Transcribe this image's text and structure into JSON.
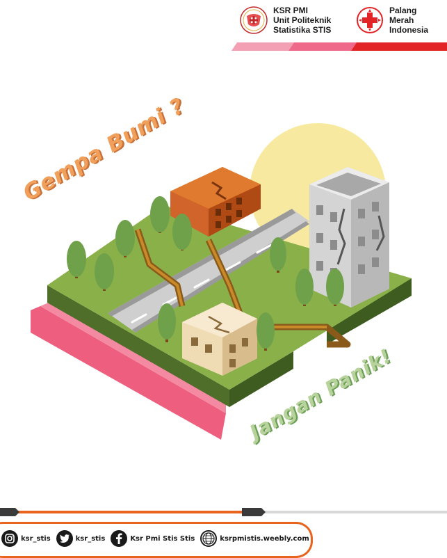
{
  "header": {
    "ksr": {
      "lines": [
        "KSR PMI",
        "Unit Politeknik",
        "Statistika STIS"
      ]
    },
    "pmi": {
      "lines": [
        "Palang",
        "Merah",
        "Indonesia"
      ]
    }
  },
  "title": {
    "line1": "Gempa Bumi ?",
    "line2": "Jangan Panik!"
  },
  "footer": {
    "instagram": "ksr_stis",
    "twitter": "ksr_stis",
    "facebook": "Ksr Pmi Stis Stis",
    "website": "ksrpmistis.weebly.com"
  },
  "colors": {
    "red": "#e32427",
    "pink": "#ef6a8a",
    "orange": "#e8641e",
    "grass": "#8ab04a",
    "ground": "#5c7a30"
  }
}
